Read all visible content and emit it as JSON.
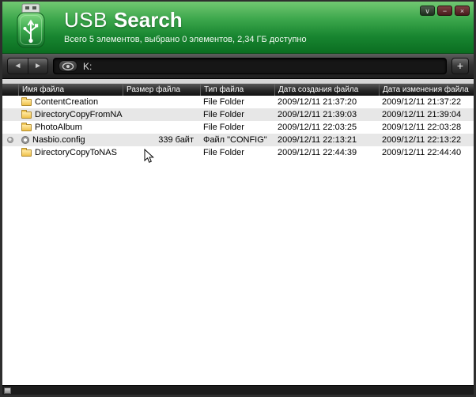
{
  "window": {
    "title_primary": "USB",
    "title_secondary": "Search",
    "status": "Всего 5 элементов, выбрано 0 элементов, 2,34 ГБ доступно",
    "controls": {
      "dropdown": "∨",
      "minimize": "−",
      "close": "×"
    }
  },
  "toolbar": {
    "back": "◄",
    "forward": "►",
    "path": "K:",
    "add": "+"
  },
  "table": {
    "columns": [
      "Имя файла",
      "Размер файла",
      "Тип файла",
      "Дата создания файла",
      "Дата изменения файла"
    ],
    "rows": [
      {
        "icon": "folder",
        "marker": false,
        "name": "ContentCreation",
        "size": "",
        "type": "File Folder",
        "created": "2009/12/11 21:37:20",
        "modified": "2009/12/11 21:37:22"
      },
      {
        "icon": "folder",
        "marker": false,
        "name": "DirectoryCopyFromNA",
        "size": "",
        "type": "File Folder",
        "created": "2009/12/11 21:39:03",
        "modified": "2009/12/11 21:39:04"
      },
      {
        "icon": "folder",
        "marker": false,
        "name": "PhotoAlbum",
        "size": "",
        "type": "File Folder",
        "created": "2009/12/11 22:03:25",
        "modified": "2009/12/11 22:03:28"
      },
      {
        "icon": "config",
        "marker": true,
        "name": "Nasbio.config",
        "size": "339 байт",
        "type": "Файл \"CONFIG\"",
        "created": "2009/12/11 22:13:21",
        "modified": "2009/12/11 22:13:22"
      },
      {
        "icon": "folder",
        "marker": false,
        "name": "DirectoryCopyToNAS",
        "size": "",
        "type": "File Folder",
        "created": "2009/12/11 22:44:39",
        "modified": "2009/12/11 22:44:40"
      }
    ]
  },
  "colors": {
    "header_green_top": "#72c872",
    "header_green_bottom": "#0b6e21",
    "titlebar_button_red": "#5c2626",
    "row_alt": "#e7e7e7"
  }
}
